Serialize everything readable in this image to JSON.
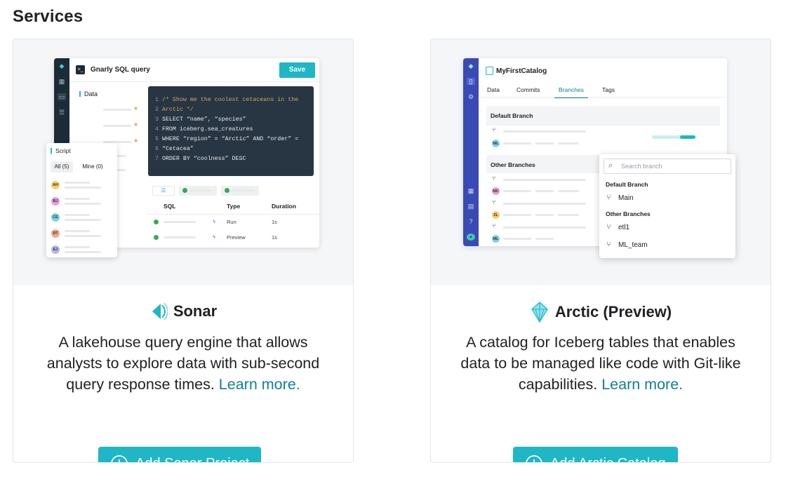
{
  "page": {
    "title": "Services"
  },
  "sonar": {
    "name": "Sonar",
    "description": "A lakehouse query engine that allows analysts to explore data with sub-second query response times.",
    "learn_more": "Learn more.",
    "button_label": "Add Sonar Project",
    "preview": {
      "window_title": "Gnarly SQL query",
      "save_label": "Save",
      "data_label": "Data",
      "code_lines": [
        "/* Show me the coolest cetaceans in the",
        "Arctic */",
        "SELECT “name”, “species”",
        "FROM iceberg.sea_creatures",
        "WHERE “region” = “Arctic” AND “order” =",
        "“Cetacea”",
        "ORDER BY “coolness” DESC"
      ],
      "results_headers": [
        "SQL",
        "Type",
        "Duration"
      ],
      "results_rows": [
        {
          "type": "Run",
          "duration": "1s"
        },
        {
          "type": "Preview",
          "duration": "1s"
        }
      ],
      "script_panel": {
        "title": "Script",
        "tab_all": "All (5)",
        "tab_mine": "Mine (0)",
        "avatars": [
          "AH",
          "BJ",
          "CE",
          "DT",
          "EJ"
        ]
      }
    }
  },
  "arctic": {
    "name": "Arctic (Preview)",
    "description": "A catalog for Iceberg tables that enables data to be managed like code with Git-like capabilities.",
    "learn_more": "Learn more.",
    "button_label": "Add Arctic Catalog",
    "preview": {
      "catalog_title": "MyFirstCatalog",
      "tabs": [
        "Data",
        "Commits",
        "Branches",
        "Tags"
      ],
      "active_tab": "Branches",
      "default_branch_label": "Default Branch",
      "other_branches_label": "Other Branches",
      "rail_avatars": [
        "ML",
        "MC",
        "ZL",
        "ML"
      ],
      "popover": {
        "search_placeholder": "Search branch",
        "default_header": "Default Branch",
        "default_item": "Main",
        "other_header": "Other Branches",
        "other_items": [
          "etl1",
          "ML_team"
        ]
      }
    }
  },
  "colors": {
    "accent": "#1fb6c5",
    "link": "#117f8c",
    "editor_bg": "#283543",
    "arctic_rail": "#3a4ab5"
  }
}
